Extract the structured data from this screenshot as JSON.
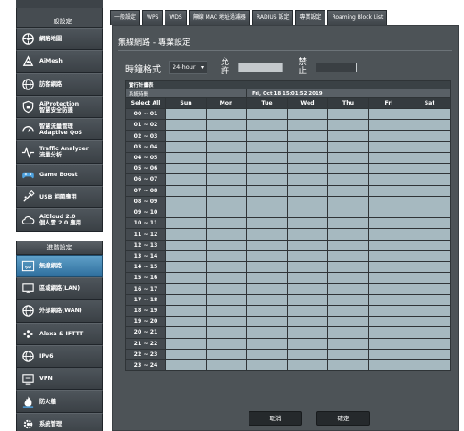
{
  "sidebar": {
    "general_header": "一般設定",
    "general_items": [
      {
        "name": "sidebar-item-network-map",
        "icon": "network-map-icon",
        "label": "網路地圖",
        "label2": ""
      },
      {
        "name": "sidebar-item-aimesh",
        "icon": "aimesh-icon",
        "label": "AiMesh",
        "label2": ""
      },
      {
        "name": "sidebar-item-guest-network",
        "icon": "globe-icon",
        "label": "訪客網路",
        "label2": ""
      },
      {
        "name": "sidebar-item-aiprotection",
        "icon": "shield-icon",
        "label": "AiProtection",
        "label2": "智慧安全防護"
      },
      {
        "name": "sidebar-item-adaptive-qos",
        "icon": "speedometer-icon",
        "label": "智慧流量管理",
        "label2": "Adaptive QoS"
      },
      {
        "name": "sidebar-item-traffic-analyzer",
        "icon": "pulse-icon",
        "label": "Traffic Analyzer",
        "label2": "流量分析"
      },
      {
        "name": "sidebar-item-game-boost",
        "icon": "gamepad-icon",
        "label": "Game Boost",
        "label2": ""
      },
      {
        "name": "sidebar-item-usb",
        "icon": "usb-icon",
        "label": "USB 相關應用",
        "label2": ""
      },
      {
        "name": "sidebar-item-aicloud",
        "icon": "cloud-icon",
        "label": "AiCloud 2.0",
        "label2": "個人雲 2.0 應用"
      }
    ],
    "advanced_header": "進階設定",
    "advanced_items": [
      {
        "name": "sidebar-item-wireless",
        "icon": "wifi-icon",
        "label": "無線網路",
        "label2": "",
        "active": true
      },
      {
        "name": "sidebar-item-lan",
        "icon": "lan-icon",
        "label": "區域網路(LAN)",
        "label2": ""
      },
      {
        "name": "sidebar-item-wan",
        "icon": "globe-icon",
        "label": "外部網路(WAN)",
        "label2": ""
      },
      {
        "name": "sidebar-item-alexa",
        "icon": "dots-icon",
        "label": "Alexa & IFTTT",
        "label2": ""
      },
      {
        "name": "sidebar-item-ipv6",
        "icon": "globe-icon",
        "label": "IPv6",
        "label2": ""
      },
      {
        "name": "sidebar-item-vpn",
        "icon": "vpn-icon",
        "label": "VPN",
        "label2": ""
      },
      {
        "name": "sidebar-item-firewall",
        "icon": "flame-icon",
        "label": "防火牆",
        "label2": ""
      },
      {
        "name": "sidebar-item-admin",
        "icon": "gear-person-icon",
        "label": "系統管理",
        "label2": ""
      }
    ]
  },
  "tabs": [
    "一般設定",
    "WPS",
    "WDS",
    "無線 MAC 地址過濾器",
    "RADIUS 設定",
    "專業設定",
    "Roaming Block List"
  ],
  "active_tab": 5,
  "page": {
    "title": "無線網路 - 專業設定",
    "clock_label": "時鐘格式",
    "clock_value": "24-hour",
    "allow_label": "允許",
    "deny_label": "禁止"
  },
  "schedule": {
    "header": "實行計畫表",
    "system_time_label": "系統時間",
    "system_time": "Fri, Oct 18 15:01:52 2019",
    "select_all": "Select All",
    "days": [
      "Sun",
      "Mon",
      "Tue",
      "Wed",
      "Thu",
      "Fri",
      "Sat"
    ],
    "hours": [
      "00 ~ 01",
      "01 ~ 02",
      "02 ~ 03",
      "03 ~ 04",
      "04 ~ 05",
      "05 ~ 06",
      "06 ~ 07",
      "07 ~ 08",
      "08 ~ 09",
      "09 ~ 10",
      "10 ~ 11",
      "11 ~ 12",
      "12 ~ 13",
      "13 ~ 14",
      "14 ~ 15",
      "15 ~ 16",
      "16 ~ 17",
      "17 ~ 18",
      "18 ~ 19",
      "19 ~ 20",
      "20 ~ 21",
      "21 ~ 22",
      "22 ~ 23",
      "23 ~ 24"
    ]
  },
  "buttons": {
    "cancel": "取消",
    "ok": "確定"
  },
  "colors": {
    "panel": "#4d5357",
    "cell_allow": "#a6b9c0",
    "active_item": "#3a7fb0"
  }
}
